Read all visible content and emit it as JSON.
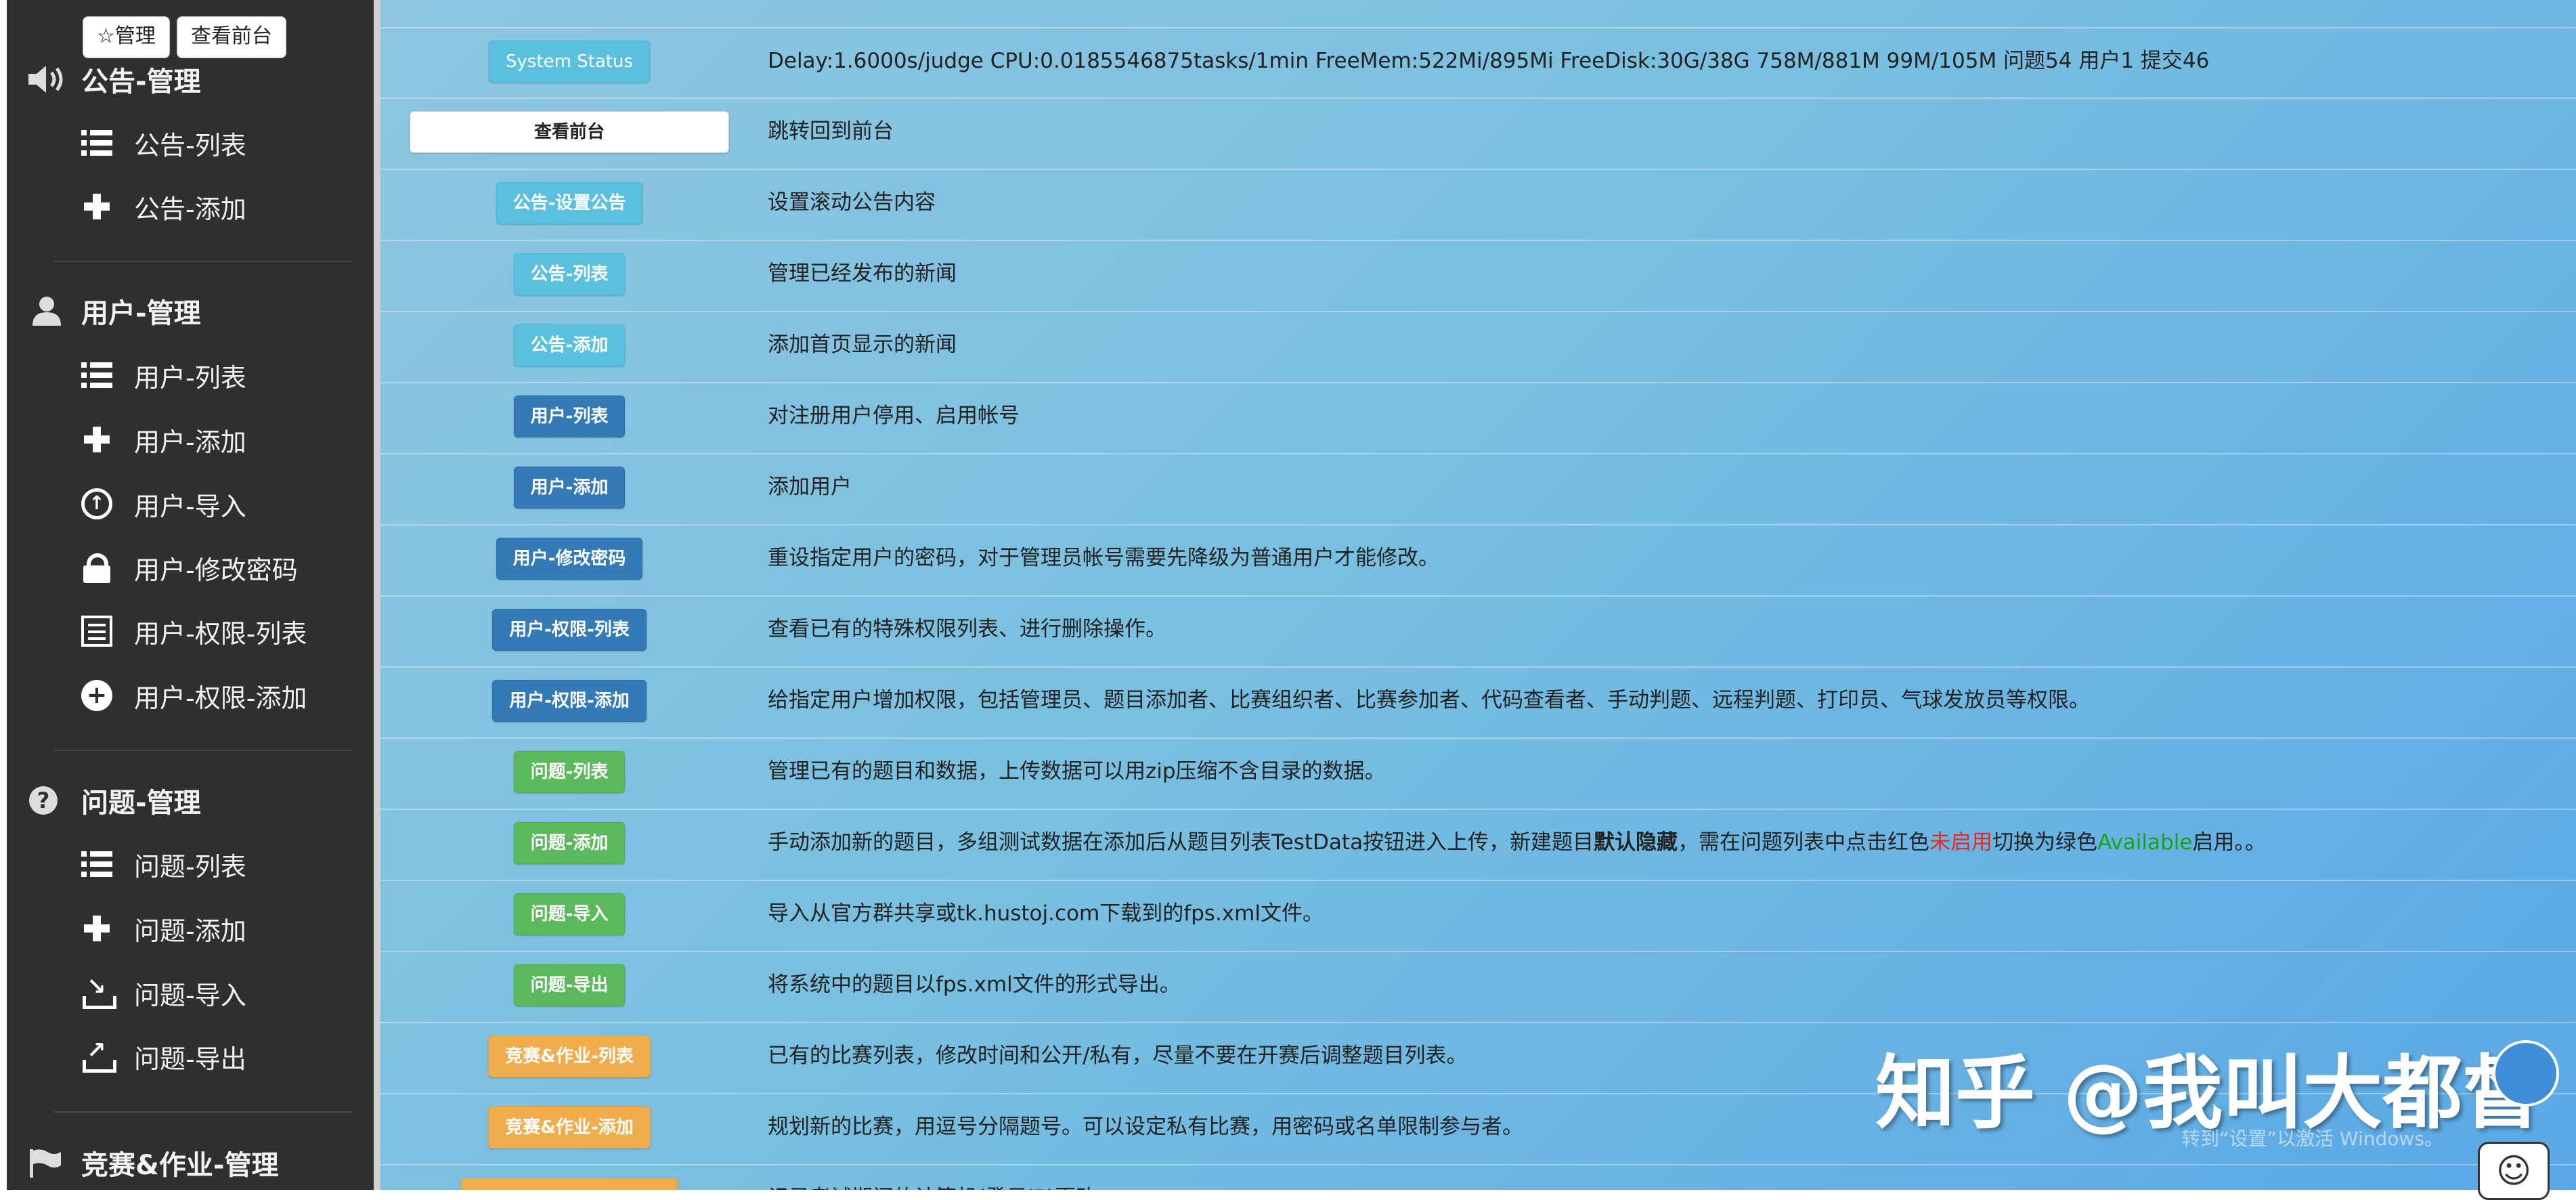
{
  "sidebar": {
    "top_buttons": [
      "☆管理",
      "查看前台"
    ],
    "sections": [
      {
        "title": "公告-管理",
        "icon": "speaker-icon",
        "items": [
          {
            "label": "公告-列表",
            "icon": "list-icon"
          },
          {
            "label": "公告-添加",
            "icon": "plus-icon"
          }
        ]
      },
      {
        "title": "用户-管理",
        "icon": "user-icon",
        "items": [
          {
            "label": "用户-列表",
            "icon": "list-icon"
          },
          {
            "label": "用户-添加",
            "icon": "plus-icon"
          },
          {
            "label": "用户-导入",
            "icon": "upload-circle-icon"
          },
          {
            "label": "用户-修改密码",
            "icon": "lock-icon"
          },
          {
            "label": "用户-权限-列表",
            "icon": "document-list-icon"
          },
          {
            "label": "用户-权限-添加",
            "icon": "plus-circle-icon"
          }
        ]
      },
      {
        "title": "问题-管理",
        "icon": "question-circle-icon",
        "items": [
          {
            "label": "问题-列表",
            "icon": "list-icon"
          },
          {
            "label": "问题-添加",
            "icon": "plus-icon"
          },
          {
            "label": "问题-导入",
            "icon": "import-icon"
          },
          {
            "label": "问题-导出",
            "icon": "export-icon"
          }
        ]
      },
      {
        "title": "竞赛&作业-管理",
        "icon": "flag-icon",
        "items": []
      }
    ]
  },
  "rows": [
    {
      "button": "System Status",
      "style": "info",
      "desc": "Delay:1.6000s/judge   CPU:0.0185546875tasks/1min   FreeMem:522Mi/895Mi   FreeDisk:30G/38G 758M/881M 99M/105M   问题54  用户1  提交46"
    },
    {
      "button": "查看前台",
      "style": "light",
      "desc": "跳转回到前台"
    },
    {
      "button": "公告-设置公告",
      "style": "info",
      "desc": "设置滚动公告内容"
    },
    {
      "button": "公告-列表",
      "style": "info",
      "desc": "管理已经发布的新闻"
    },
    {
      "button": "公告-添加",
      "style": "info",
      "desc": "添加首页显示的新闻"
    },
    {
      "button": "用户-列表",
      "style": "primary",
      "desc": "对注册用户停用、启用帐号"
    },
    {
      "button": "用户-添加",
      "style": "primary",
      "desc": "添加用户"
    },
    {
      "button": "用户-修改密码",
      "style": "primary",
      "desc": "重设指定用户的密码，对于管理员帐号需要先降级为普通用户才能修改。"
    },
    {
      "button": "用户-权限-列表",
      "style": "primary",
      "desc": "查看已有的特殊权限列表、进行删除操作。"
    },
    {
      "button": "用户-权限-添加",
      "style": "primary",
      "desc": "给指定用户增加权限，包括管理员、题目添加者、比赛组织者、比赛参加者、代码查看者、手动判题、远程判题、打印员、气球发放员等权限。"
    },
    {
      "button": "问题-列表",
      "style": "success",
      "desc": "管理已有的题目和数据，上传数据可以用zip压缩不含目录的数据。"
    },
    {
      "button": "问题-添加",
      "style": "success",
      "desc_parts": [
        "手动添加新的题目，多组测试数据在添加后从题目列表TestData按钮进入上传，新建题目",
        "默认隐藏",
        "，需在问题列表中点击红色",
        "未启用",
        "切换为绿色",
        "Available",
        "启用。。"
      ]
    },
    {
      "button": "问题-导入",
      "style": "success",
      "desc": "导入从官方群共享或tk.hustoj.com下载到的fps.xml文件。"
    },
    {
      "button": "问题-导出",
      "style": "success",
      "desc": "将系统中的题目以fps.xml文件的形式导出。"
    },
    {
      "button": "竞赛&作业-列表",
      "style": "warning",
      "desc": "已有的比赛列表，修改时间和公开/私有，尽量不要在开赛后调整题目列表。"
    },
    {
      "button": "竞赛&作业-添加",
      "style": "warning",
      "desc": "规划新的比赛，用逗号分隔题号。可以设定私有比赛，用密码或名单限制参与者。"
    },
    {
      "button": "",
      "style": "warning",
      "desc": "记录考试期间的计算机(登录IP)更改"
    }
  ],
  "watermark": {
    "text": "知乎 @我叫大都督",
    "subtext": "转到“设置”以激活 Windows。"
  }
}
